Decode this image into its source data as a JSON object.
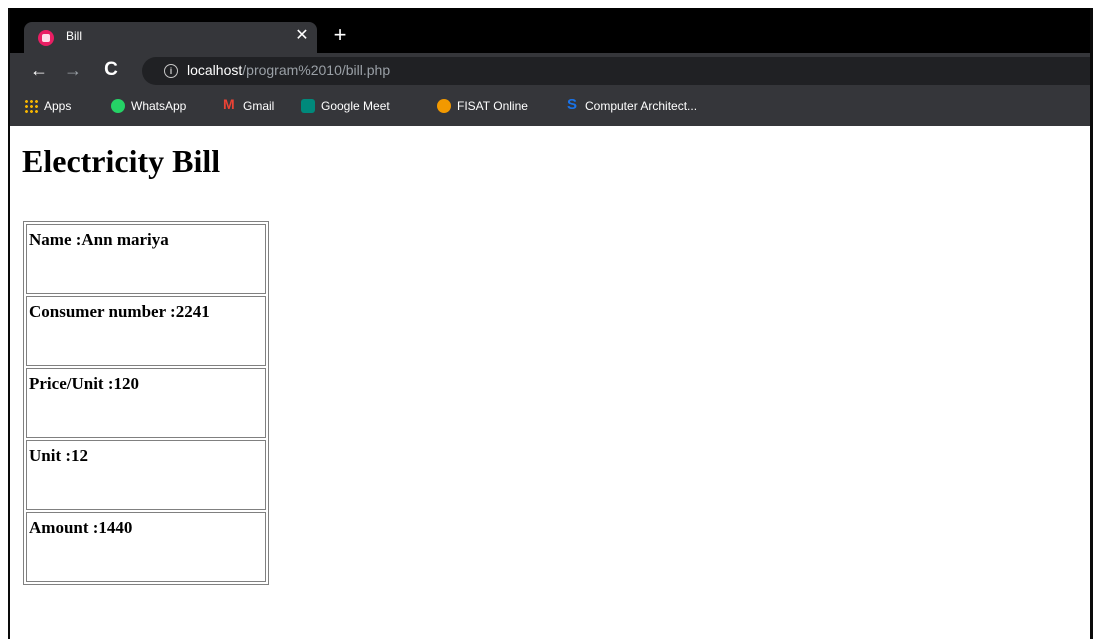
{
  "browser": {
    "tab": {
      "title": "Bill",
      "close_glyph": "✕",
      "favicon": "page-favicon"
    },
    "new_tab_glyph": "+",
    "nav": {
      "back_glyph": "←",
      "forward_glyph": "→",
      "reload_glyph": "C",
      "info_glyph": "i"
    },
    "url": {
      "host": "localhost",
      "path": "/program%2010/bill.php"
    },
    "bookmarks": [
      {
        "label": "Apps",
        "icon": "apps-grid-icon"
      },
      {
        "label": "WhatsApp",
        "icon": "whatsapp-icon"
      },
      {
        "label": "Gmail",
        "icon": "gmail-icon"
      },
      {
        "label": "Google Meet",
        "icon": "google-meet-icon"
      },
      {
        "label": "FISAT Online",
        "icon": "fisat-icon"
      },
      {
        "label": "Computer Architect...",
        "icon": "computer-architecture-icon"
      }
    ]
  },
  "page": {
    "heading": "Electricity Bill",
    "rows": [
      {
        "label": "Name :",
        "value": "Ann mariya"
      },
      {
        "label": "Consumer number :",
        "value": "2241"
      },
      {
        "label": "Price/Unit :",
        "value": "120"
      },
      {
        "label": "Unit :",
        "value": "12"
      },
      {
        "label": "Amount :",
        "value": "1440"
      }
    ]
  }
}
